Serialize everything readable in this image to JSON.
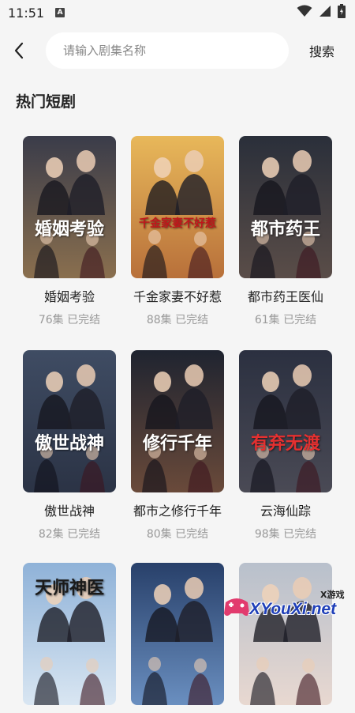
{
  "status": {
    "time": "11:51",
    "a_badge": "A"
  },
  "header": {
    "search_placeholder": "请输入剧集名称",
    "search_label": "搜索"
  },
  "section": {
    "title": "热门短剧"
  },
  "items": [
    {
      "title": "婚姻考验",
      "meta": "76集 已完结",
      "poster_text": "婚姻考验",
      "colors": [
        "#3a3c4a",
        "#8a6f4e"
      ],
      "text_color": "#ffffff"
    },
    {
      "title": "千金家妻不好惹",
      "meta": "88集 已完结",
      "poster_text": "千金家妻不好惹",
      "colors": [
        "#e8b85a",
        "#b8703a"
      ],
      "text_color": "#c0161b"
    },
    {
      "title": "都市药王医仙",
      "meta": "61集 已完结",
      "poster_text": "都市药王",
      "colors": [
        "#2a2f3a",
        "#5a4d48"
      ],
      "text_color": "#ffffff"
    },
    {
      "title": "傲世战神",
      "meta": "82集 已完结",
      "poster_text": "傲世战神",
      "colors": [
        "#3f4c63",
        "#2b3345"
      ],
      "text_color": "#ffffff"
    },
    {
      "title": "都市之修行千年",
      "meta": "80集 已完结",
      "poster_text": "修行千年",
      "colors": [
        "#1f2430",
        "#6a4a3a"
      ],
      "text_color": "#ffffff"
    },
    {
      "title": "云海仙踪",
      "meta": "98集 已完结",
      "poster_text": "有弃无渡",
      "colors": [
        "#2b3040",
        "#4a4a55"
      ],
      "text_color": "#e53030"
    },
    {
      "title": "",
      "meta": "",
      "poster_text": "天师神医",
      "colors": [
        "#8fb2d8",
        "#d9e6f2"
      ],
      "text_color": "#1a1a1a"
    },
    {
      "title": "",
      "meta": "",
      "poster_text": "",
      "colors": [
        "#28406a",
        "#6a8fc0"
      ],
      "text_color": "#ffffff"
    },
    {
      "title": "",
      "meta": "",
      "poster_text": "",
      "colors": [
        "#b8c0cc",
        "#e8d8d0"
      ],
      "text_color": "#ffffff"
    }
  ],
  "watermark": {
    "brand": "XYouXi.net",
    "tag": "X游戏"
  }
}
